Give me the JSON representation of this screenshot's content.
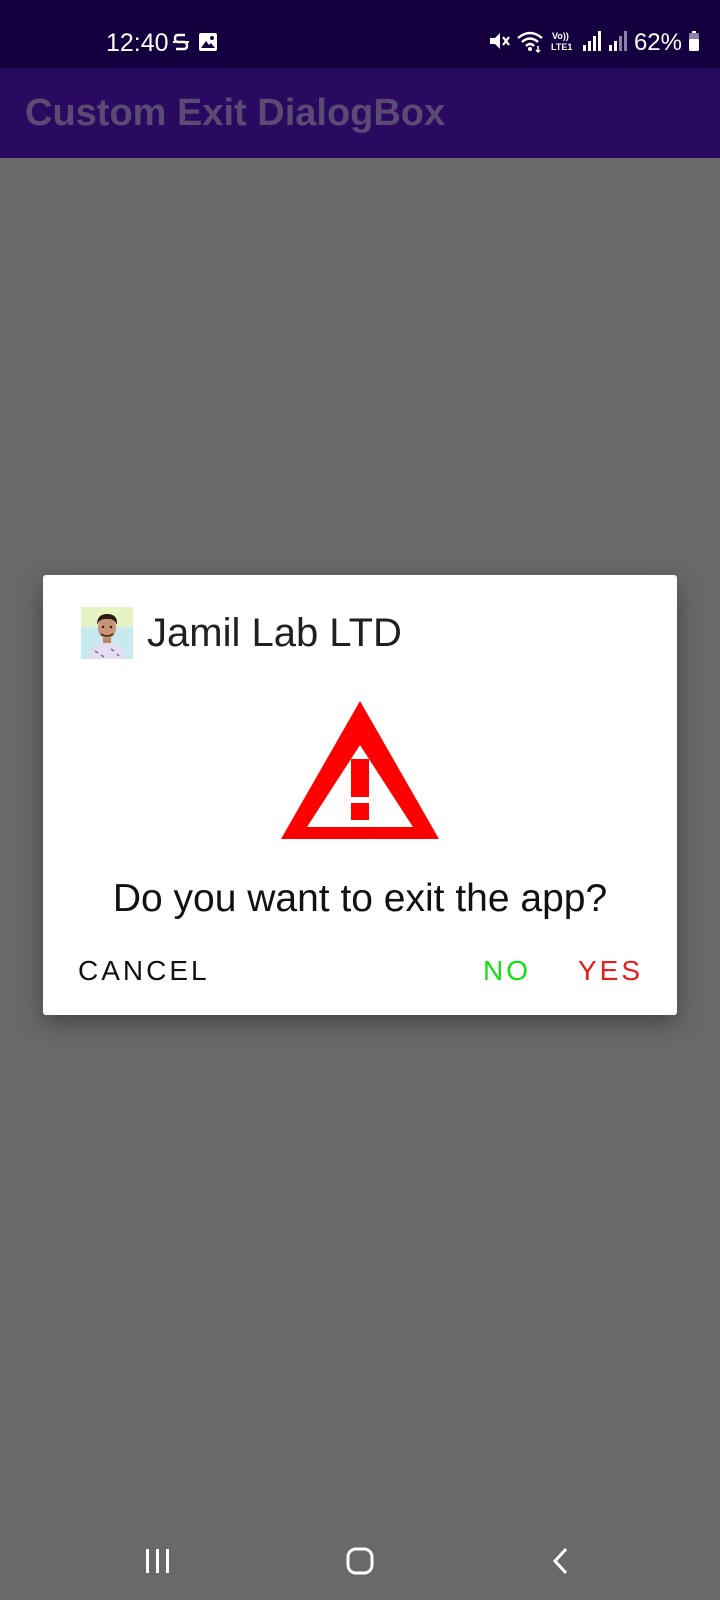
{
  "status_bar": {
    "time": "12:40",
    "battery": "62%",
    "left_icons": [
      "data-saver-icon",
      "gallery-notification-icon"
    ],
    "right_icons": [
      "mute-icon",
      "wifi-icon",
      "volte-icon",
      "signal-sim1-icon",
      "signal-sim2-icon",
      "battery-icon"
    ],
    "volte_label": "Vo)) LTE1"
  },
  "app_bar": {
    "title": "Custom Exit DialogBox"
  },
  "dialog": {
    "title": "Jamil Lab LTD",
    "icon": "warning-triangle-icon",
    "message": "Do you want to exit the app?",
    "buttons": {
      "cancel": "CANCEL",
      "no": "NO",
      "yes": "YES"
    },
    "colors": {
      "warning": "#ff0000",
      "no": "#12e012",
      "yes": "#e41e1e"
    }
  },
  "nav_bar": {
    "buttons": [
      "recents-icon",
      "home-icon",
      "back-icon"
    ]
  },
  "colors": {
    "status_bar": "#14003f",
    "app_bar": "#2a0a60",
    "scrim": "#696969"
  }
}
